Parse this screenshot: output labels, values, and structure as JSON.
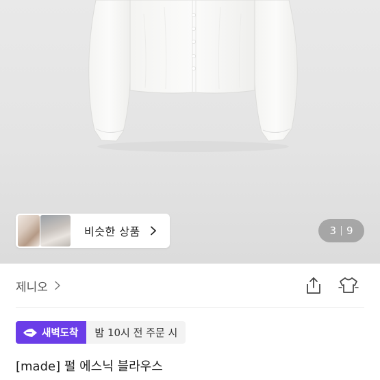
{
  "gallery": {
    "similar_label": "비슷한 상품",
    "counter_current": "3",
    "counter_total": "9"
  },
  "shop": {
    "name": "제니오"
  },
  "delivery": {
    "badge_label": "새벽도착",
    "order_deadline": "밤 10시 전 주문 시",
    "badge_color": "#6b3de8"
  },
  "product": {
    "title": "[made] 펄 에스닉 블라우스"
  },
  "icons": [
    "chevron-right-icon",
    "share-icon",
    "hanger-icon",
    "dawn-arrow-icon"
  ]
}
